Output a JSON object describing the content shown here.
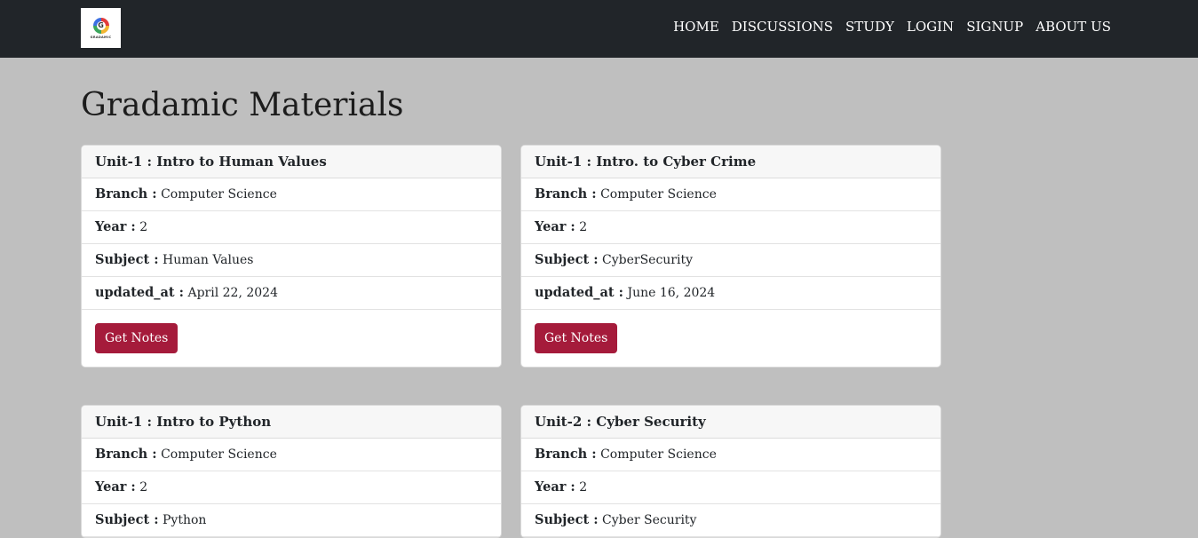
{
  "brand": {
    "logo_letter": "G",
    "logo_text": "GRADAMIC"
  },
  "nav": [
    "HOME",
    "DISCUSSIONS",
    "STUDY",
    "LOGIN",
    "SIGNUP",
    "ABOUT US"
  ],
  "page_title": "Gradamic Materials",
  "labels": {
    "branch": "Branch :",
    "year": "Year :",
    "subject": "Subject :",
    "updated_at": "updated_at :",
    "button": "Get Notes"
  },
  "cards": [
    {
      "title": "Unit-1 : Intro to Human Values",
      "branch": "Computer Science",
      "year": "2",
      "subject": "Human Values",
      "updated_at": "April 22, 2024"
    },
    {
      "title": "Unit-1 : Intro. to Cyber Crime",
      "branch": "Computer Science",
      "year": "2",
      "subject": "CyberSecurity",
      "updated_at": "June 16, 2024"
    },
    {
      "title": "Unit-1 : Intro to Python",
      "branch": "Computer Science",
      "year": "2",
      "subject": "Python"
    },
    {
      "title": "Unit-2 : Cyber Security",
      "branch": "Computer Science",
      "year": "2",
      "subject": "Cyber Security"
    }
  ],
  "colors": {
    "navbar": "#212529",
    "background": "#bfbfbf",
    "button": "#a51b3b"
  }
}
